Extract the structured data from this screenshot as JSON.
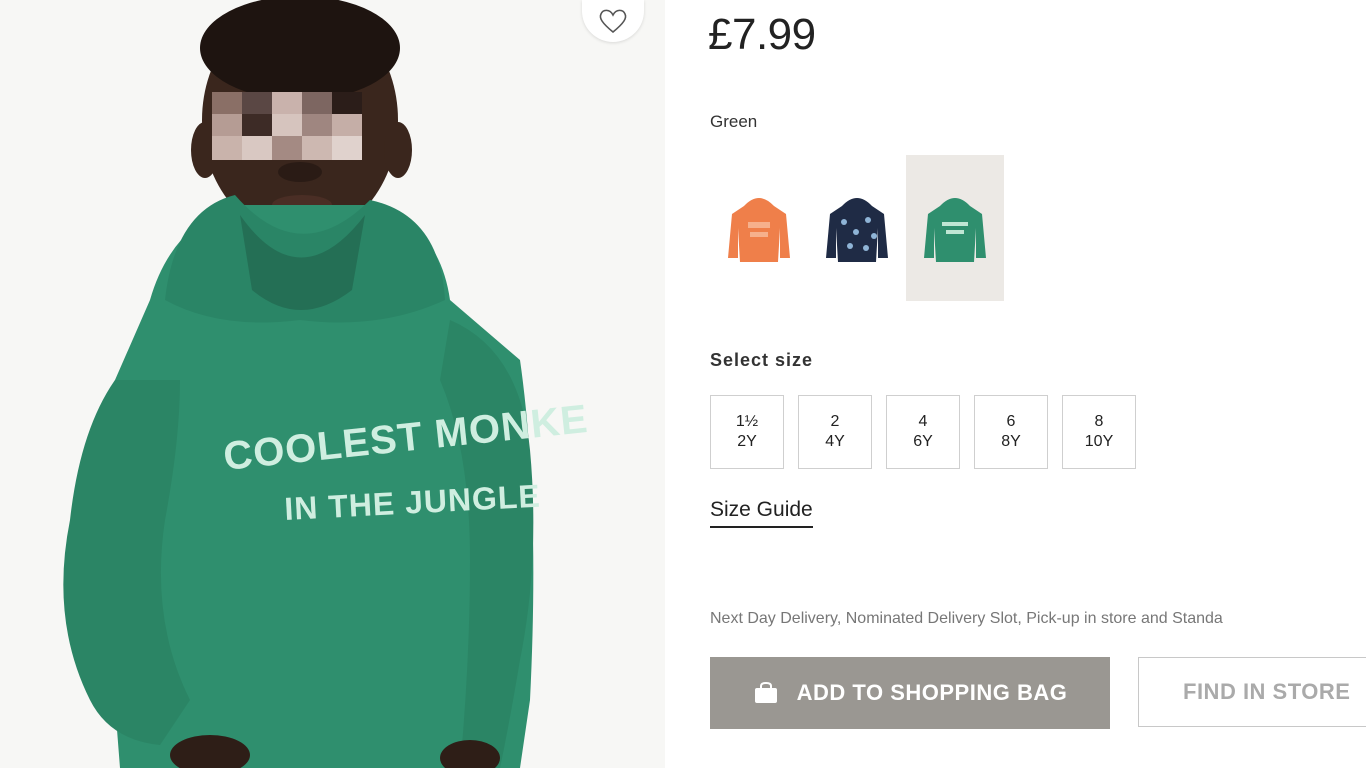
{
  "product": {
    "title_fragment": "",
    "price": "£7.99",
    "hoodie_print": {
      "line1": "COOLEST MONKE",
      "line2": "IN THE JUNGLE"
    }
  },
  "colors": {
    "selected_label": "Green",
    "swatches": [
      {
        "name": "orange",
        "hex": "#ef7f4a"
      },
      {
        "name": "navy",
        "hex": "#1f2b45"
      },
      {
        "name": "green",
        "hex": "#2f8f6e"
      }
    ]
  },
  "sizes": {
    "label": "Select size",
    "options": [
      {
        "top": "1½",
        "bottom": "2Y"
      },
      {
        "top": "2",
        "bottom": "4Y"
      },
      {
        "top": "4",
        "bottom": "6Y"
      },
      {
        "top": "6",
        "bottom": "8Y"
      },
      {
        "top": "8",
        "bottom": "10Y"
      }
    ],
    "guide_label": "Size Guide"
  },
  "delivery": {
    "text": "Next Day Delivery, Nominated Delivery Slot, Pick-up in store and Standa"
  },
  "actions": {
    "add_to_bag": "ADD TO SHOPPING BAG",
    "find_in_store": "FIND IN STORE"
  },
  "icons": {
    "wishlist": "heart-icon",
    "bag": "shopping-bag-icon"
  },
  "colors_ui": {
    "add_button_bg": "#9a9792",
    "hoodie_green": "#2f8f6e"
  }
}
